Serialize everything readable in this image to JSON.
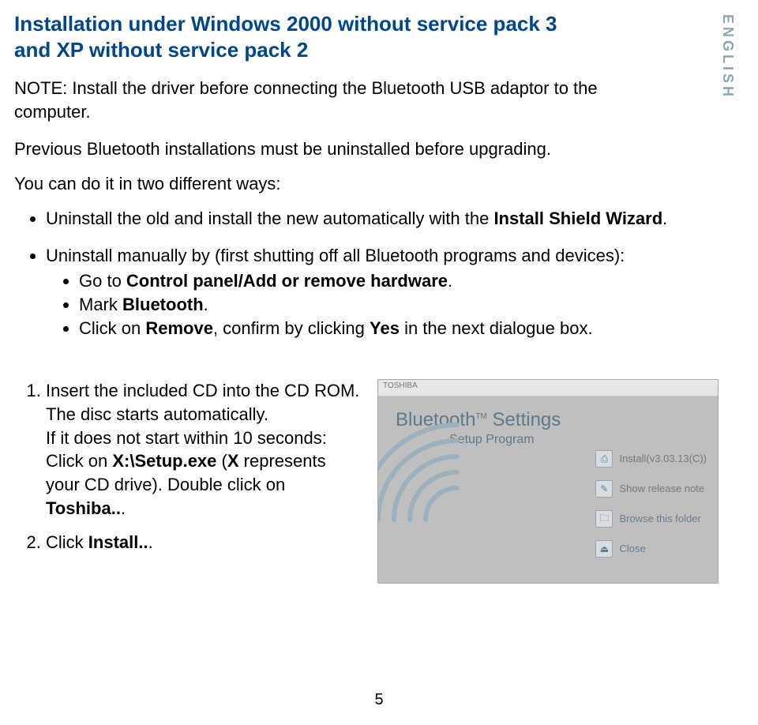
{
  "side_label": "ENGLISH",
  "heading_line1": "Installation under Windows 2000 without service pack 3",
  "heading_line2": "and XP without service pack 2",
  "note": "NOTE: Install the driver before connecting the Bluetooth USB adaptor to the computer.",
  "para1": "Previous Bluetooth installations must be uninstalled before upgrading.",
  "para2": "You can do it in two different ways:",
  "bullet1_pre": "Uninstall the old and install the new automatically with the ",
  "bullet1_b1": "Install Shield Wizard",
  "bullet1_post": ".",
  "bullet2_lead": "Uninstall manually by (first shutting off all Bluetooth programs and devices):",
  "sub1_pre": "Go to ",
  "sub1_b": "Control panel/Add or remove hardware",
  "sub1_post": ".",
  "sub2_pre": "Mark ",
  "sub2_b": "Bluetooth",
  "sub2_post": ".",
  "sub3_pre": "Click on ",
  "sub3_b1": "Remove",
  "sub3_mid": ", confirm by clicking ",
  "sub3_b2": "Yes",
  "sub3_post": " in the next dialogue box.",
  "step1_a": "Insert the included CD into the CD ROM. The disc starts automatically.",
  "step1_b_pre": "If it does not start within 10 seconds: Click on ",
  "step1_b_b1": "X:\\Setup.exe",
  "step1_c_pre": "(",
  "step1_c_b1": "X",
  "step1_c_post": " represents your CD drive).",
  "step1_d_pre": "Double click on ",
  "step1_d_b1": "Toshiba..",
  "step1_d_post": ".",
  "step2_pre": "Click ",
  "step2_b": "Install..",
  "step2_post": ".",
  "setup": {
    "brand": "TOSHIBA",
    "title_l": "Bluetooth",
    "title_tm": "TM",
    "title_r": " Settings",
    "subtitle": "Setup Program",
    "items": [
      {
        "label": "Install(v3.03.13(C))"
      },
      {
        "label": "Show release note"
      },
      {
        "label": "Browse this folder"
      },
      {
        "label": "Close"
      }
    ]
  },
  "page_number": "5"
}
